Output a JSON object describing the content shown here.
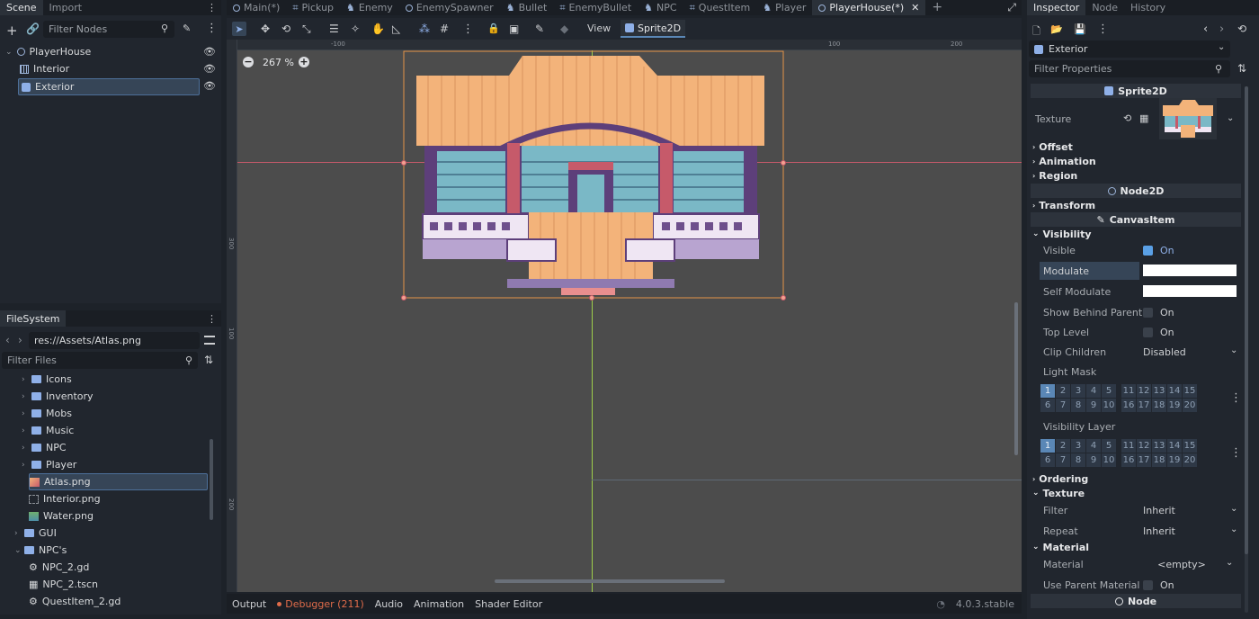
{
  "top_tabs": {
    "left": [
      "Scene",
      "Import"
    ],
    "editor": [
      "Main(*)",
      "Pickup",
      "Enemy",
      "EnemySpawner",
      "Bullet",
      "EnemyBullet",
      "NPC",
      "QuestItem",
      "Player",
      "PlayerHouse(*)"
    ],
    "right": [
      "Inspector",
      "Node",
      "History"
    ]
  },
  "scene": {
    "filter_placeholder": "Filter Nodes",
    "nodes": [
      "PlayerHouse",
      "Interior",
      "Exterior"
    ]
  },
  "filesystem": {
    "title": "FileSystem",
    "path": "res://Assets/Atlas.png",
    "filter_placeholder": "Filter Files",
    "items": [
      "Icons",
      "Inventory",
      "Mobs",
      "Music",
      "NPC",
      "Player",
      "Atlas.png",
      "Interior.png",
      "Water.png",
      "GUI",
      "NPC's",
      "NPC_2.gd",
      "NPC_2.tscn",
      "QuestItem_2.gd"
    ]
  },
  "viewport": {
    "zoom": "267 %",
    "view_label": "View",
    "sprite_label": "Sprite2D",
    "ruler_labels": [
      "-100",
      "100",
      "200",
      "300",
      "100",
      "200"
    ]
  },
  "bottom": {
    "tabs": [
      "Output",
      "Debugger (211)",
      "Audio",
      "Animation",
      "Shader Editor"
    ],
    "version": "4.0.3.stable",
    "debugger_color": "#e06c4a"
  },
  "inspector": {
    "object": "Exterior",
    "filter_placeholder": "Filter Properties",
    "sections": {
      "sprite": "Sprite2D",
      "node2d": "Node2D",
      "canvas": "CanvasItem",
      "node": "Node"
    },
    "texture_label": "Texture",
    "categories": [
      "Offset",
      "Animation",
      "Region",
      "Transform",
      "Visibility",
      "Ordering",
      "Texture",
      "Material"
    ],
    "props": {
      "visible": "Visible",
      "visible_val": "On",
      "modulate": "Modulate",
      "self_modulate": "Self Modulate",
      "show_behind": "Show Behind Parent",
      "show_behind_val": "On",
      "top_level": "Top Level",
      "top_level_val": "On",
      "clip": "Clip Children",
      "clip_val": "Disabled",
      "light_mask": "Light Mask",
      "vis_layer": "Visibility Layer",
      "filter": "Filter",
      "filter_val": "Inherit",
      "repeat": "Repeat",
      "repeat_val": "Inherit",
      "material": "Material",
      "material_val": "<empty>",
      "use_parent": "Use Parent Material",
      "use_parent_val": "On"
    },
    "layer_row1": [
      "1",
      "2",
      "3",
      "4",
      "5",
      "11",
      "12",
      "13",
      "14",
      "15"
    ],
    "layer_row2": [
      "6",
      "7",
      "8",
      "9",
      "10",
      "16",
      "17",
      "18",
      "19",
      "20"
    ],
    "accent": "#5a87b6"
  }
}
